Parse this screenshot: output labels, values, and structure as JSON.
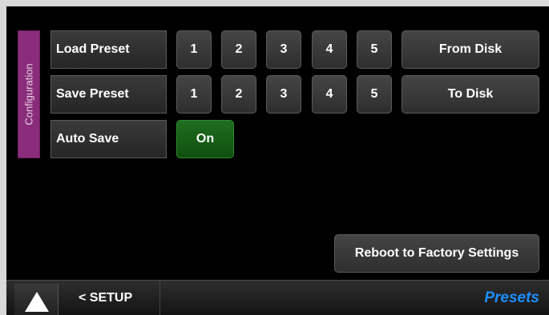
{
  "section": {
    "label": "Configuration"
  },
  "load_preset": {
    "label": "Load Preset",
    "slots": [
      "1",
      "2",
      "3",
      "4",
      "5"
    ],
    "disk_button": "From Disk"
  },
  "save_preset": {
    "label": "Save Preset",
    "slots": [
      "1",
      "2",
      "3",
      "4",
      "5"
    ],
    "disk_button": "To Disk"
  },
  "auto_save": {
    "label": "Auto Save",
    "value": "On",
    "value_color": "#1f6e1f"
  },
  "factory_reset": {
    "label": "Reboot to Factory Settings"
  },
  "footer": {
    "home_icon": "triangle-up-icon",
    "back_label": "< SETUP",
    "page_title": "Presets",
    "page_title_color": "#1b8fff"
  },
  "colors": {
    "background": "#000000",
    "section_tab": "#8a2c7b",
    "button": "#3a3a3a"
  }
}
